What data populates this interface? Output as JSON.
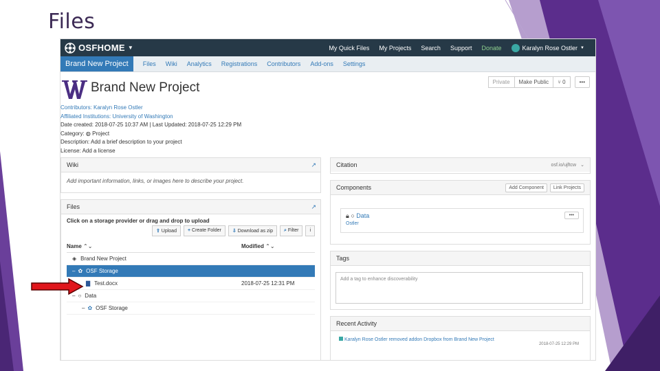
{
  "slide": {
    "title": "Files"
  },
  "topbar": {
    "brand": "OSFHOME",
    "links": [
      "My Quick Files",
      "My Projects",
      "Search",
      "Support",
      "Donate"
    ],
    "user": "Karalyn Rose Ostler"
  },
  "projnav": {
    "active": "Brand New Project",
    "tabs": [
      "Files",
      "Wiki",
      "Analytics",
      "Registrations",
      "Contributors",
      "Add-ons",
      "Settings"
    ]
  },
  "project": {
    "title": "Brand New Project",
    "privacy": "Private",
    "make_public": "Make Public",
    "forks": "0",
    "contributors": "Contributors: Karalyn Rose Ostler",
    "affiliated": "Affiliated Institutions: University of Washington",
    "dates": "Date created: 2018-07-25 10:37 AM | Last Updated: 2018-07-25 12:29 PM",
    "category": "Category:",
    "category_value": "Project",
    "description": "Description: Add a brief description to your project",
    "license": "License: Add a license"
  },
  "wiki": {
    "title": "Wiki",
    "placeholder": "Add important information, links, or images here to describe your project."
  },
  "files": {
    "title": "Files",
    "instruction": "Click on a storage provider or drag and drop to upload",
    "buttons": [
      "Upload",
      "Create Folder",
      "Download as zip",
      "Filter"
    ],
    "col_name": "Name",
    "col_modified": "Modified",
    "rows": [
      {
        "name": "Brand New Project",
        "modified": ""
      },
      {
        "name": "OSF Storage",
        "modified": ""
      },
      {
        "name": "Test.docx",
        "modified": "2018-07-25 12:31 PM"
      },
      {
        "name": "Data",
        "modified": ""
      },
      {
        "name": "OSF Storage",
        "modified": ""
      }
    ]
  },
  "citation": {
    "title": "Citation",
    "short_url": "osf.io/ujftcw"
  },
  "components": {
    "title": "Components",
    "add_button": "Add Component",
    "link_button": "Link Projects",
    "item_name": "Data",
    "item_owner": "Ostler"
  },
  "tags": {
    "title": "Tags",
    "placeholder": "Add a tag to enhance discoverability"
  },
  "activity": {
    "title": "Recent Activity",
    "item": "Karalyn Rose Ostler removed addon Dropbox from Brand New Project",
    "time": "2018-07-25 12:29 PM"
  }
}
